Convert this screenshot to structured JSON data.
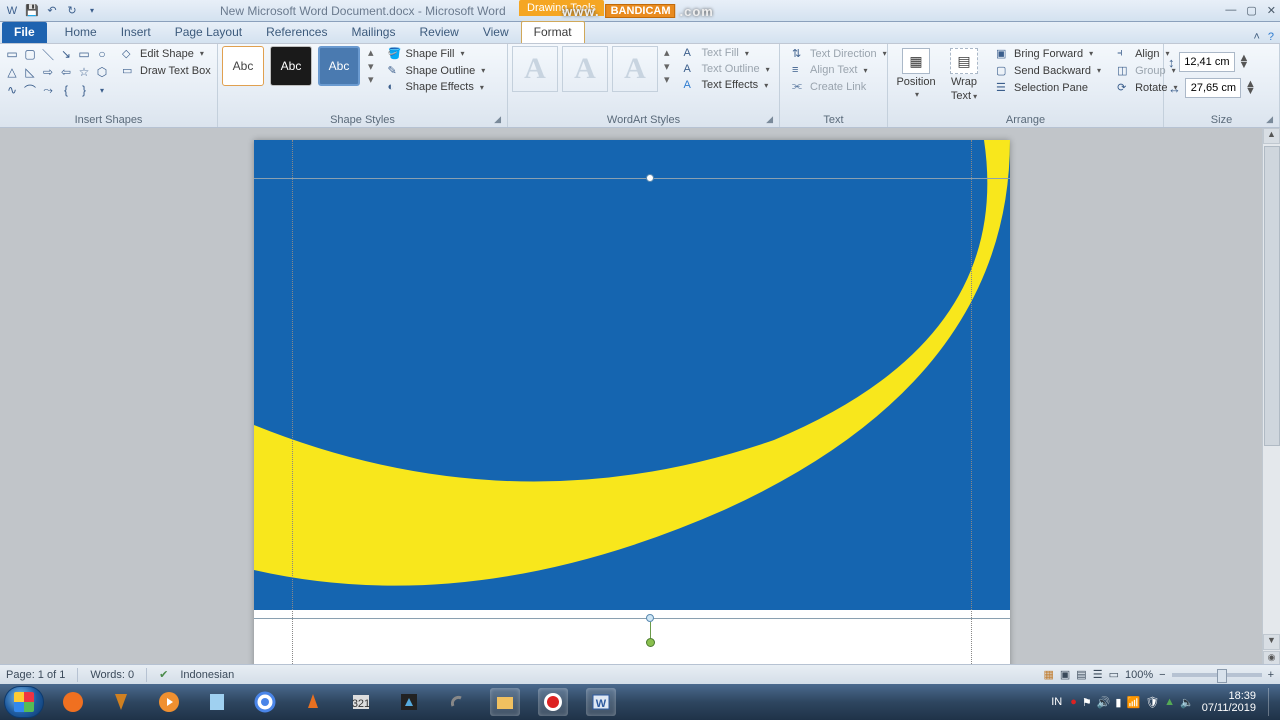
{
  "window": {
    "title": "New Microsoft Word Document.docx - Microsoft Word",
    "contextual_tab_group": "Drawing Tools"
  },
  "watermark": {
    "prefix": "www.",
    "brand": "BANDICAM",
    "suffix": ".com"
  },
  "tabs": {
    "file": "File",
    "home": "Home",
    "insert": "Insert",
    "page_layout": "Page Layout",
    "references": "References",
    "mailings": "Mailings",
    "review": "Review",
    "view": "View",
    "format": "Format"
  },
  "ribbon": {
    "insert_shapes": {
      "label": "Insert Shapes",
      "edit_shape": "Edit Shape",
      "draw_text_box": "Draw Text Box"
    },
    "shape_styles": {
      "label": "Shape Styles",
      "swatch": "Abc",
      "shape_fill": "Shape Fill",
      "shape_outline": "Shape Outline",
      "shape_effects": "Shape Effects"
    },
    "wordart_styles": {
      "label": "WordArt Styles",
      "glyph": "A",
      "text_fill": "Text Fill",
      "text_outline": "Text Outline",
      "text_effects": "Text Effects"
    },
    "text": {
      "label": "Text",
      "text_direction": "Text Direction",
      "align_text": "Align Text",
      "create_link": "Create Link"
    },
    "arrange": {
      "label": "Arrange",
      "position": "Position",
      "wrap_text1": "Wrap",
      "wrap_text2": "Text",
      "bring_forward": "Bring Forward",
      "send_backward": "Send Backward",
      "selection_pane": "Selection Pane",
      "align": "Align",
      "group": "Group",
      "rotate": "Rotate"
    },
    "size": {
      "label": "Size",
      "height": "12,41 cm",
      "width": "27,65 cm"
    }
  },
  "status": {
    "page": "Page: 1 of 1",
    "words": "Words: 0",
    "language": "Indonesian",
    "zoom": "100%"
  },
  "canvas": {
    "blue": "#1565b0",
    "yellow": "#f8e71c"
  },
  "tray": {
    "lang": "IN",
    "time": "18:39",
    "date": "07/11/2019"
  }
}
